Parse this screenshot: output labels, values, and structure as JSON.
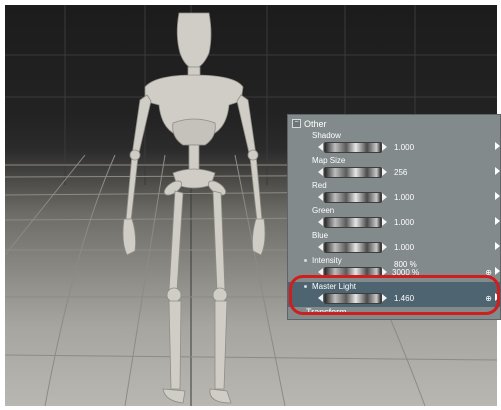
{
  "panel": {
    "group_title": "Other",
    "collapse_symbol": "−",
    "properties": [
      {
        "label": "Shadow",
        "value": "1.000"
      },
      {
        "label": "Map Size",
        "value": "256"
      },
      {
        "label": "Red",
        "value": "1.000"
      },
      {
        "label": "Green",
        "value": "1.000"
      },
      {
        "label": "Blue",
        "value": "1.000"
      },
      {
        "label": "Intensity",
        "value": "800 %",
        "value2": "3000 %"
      },
      {
        "label": "Master Light",
        "value": "1.460"
      }
    ],
    "next_section": "Transform"
  },
  "colors": {
    "panel_bg": "#838a8c",
    "selected_row": "#4e6470",
    "highlight_ring": "#cf1e1e"
  }
}
